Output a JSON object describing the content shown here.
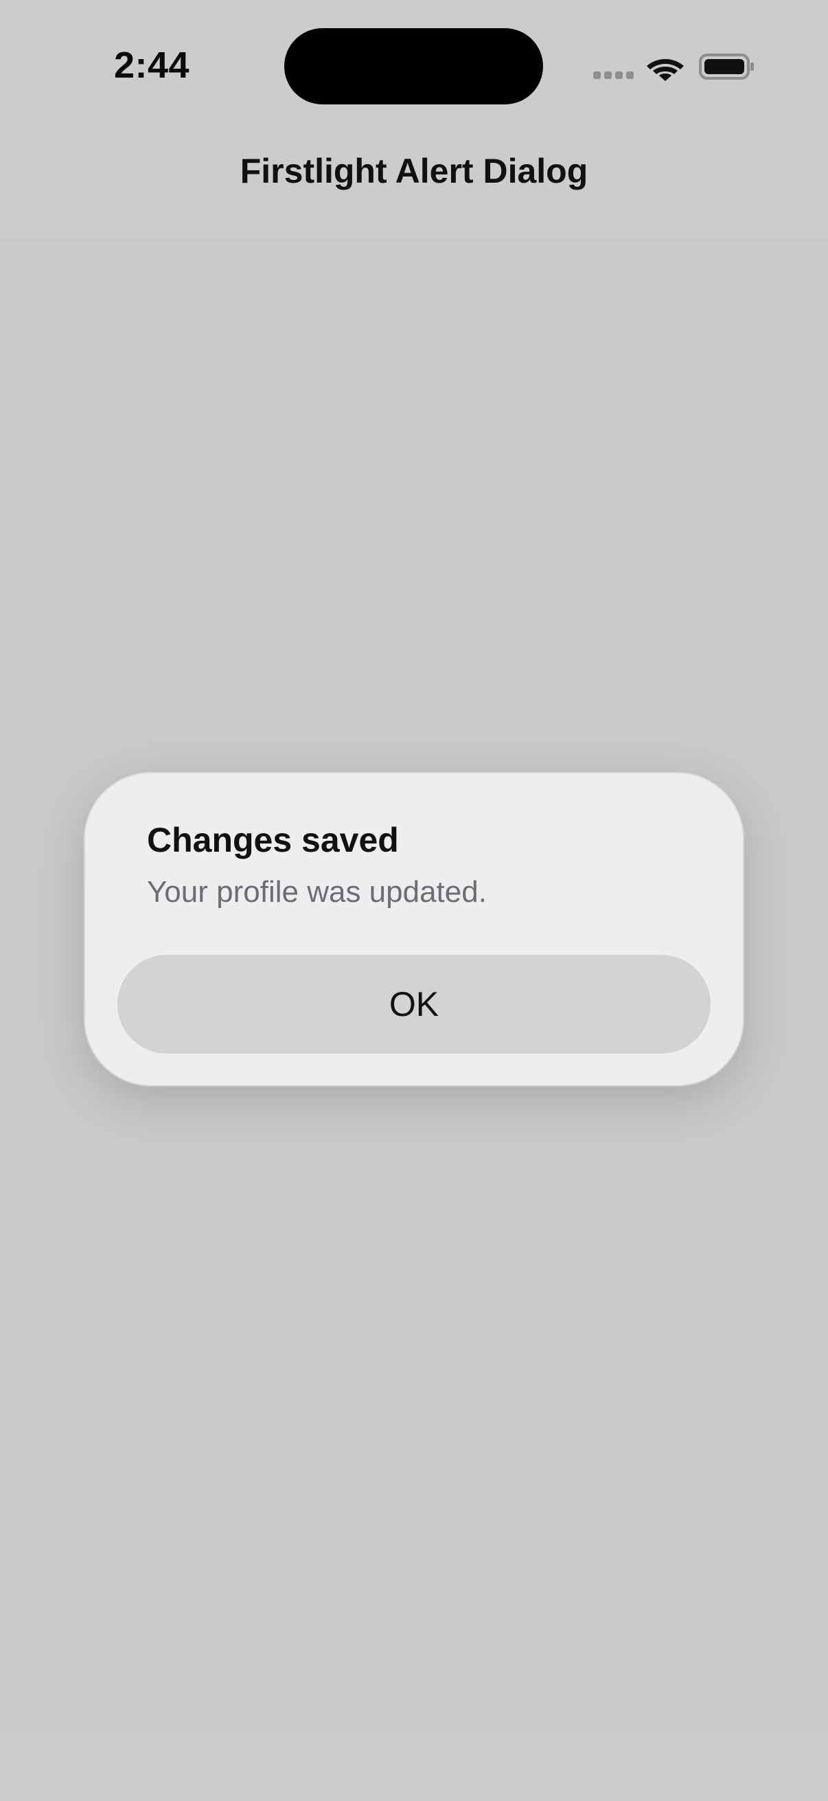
{
  "status_bar": {
    "time": "2:44",
    "icons": [
      "signal-dots-icon",
      "wifi-icon",
      "battery-icon"
    ]
  },
  "nav": {
    "title": "Firstlight Alert Dialog"
  },
  "dialog": {
    "title": "Changes saved",
    "message": "Your profile was updated.",
    "ok_label": "OK"
  },
  "colors": {
    "background": "#c8c9cb",
    "header": "#cccccc",
    "dialog": "#edeef0",
    "button": "#d2d3d5",
    "message_text": "#6d6e72"
  }
}
